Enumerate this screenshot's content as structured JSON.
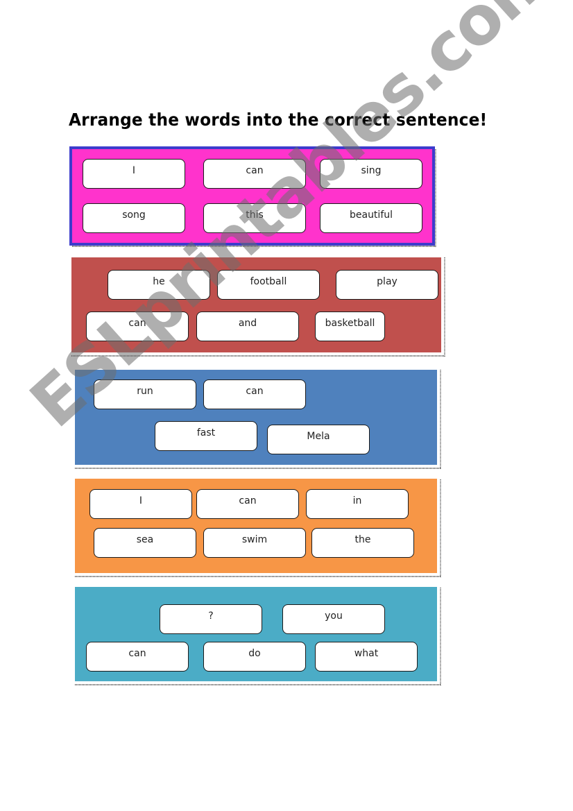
{
  "worksheet": {
    "title": "Arrange the words into the correct sentence!",
    "watermark": "ESLprintables.com",
    "panel_colors": {
      "pink": "#ff33cc",
      "pink_border": "#3c3ccc",
      "red": "#c0504d",
      "blue": "#4f81bd",
      "orange": "#f79646",
      "teal": "#4bacc6"
    },
    "panels": [
      {
        "color": "pink",
        "words": [
          "I",
          "can",
          "sing",
          "song",
          "this",
          "beautiful"
        ]
      },
      {
        "color": "red",
        "words": [
          "he",
          "football",
          "play",
          "can",
          "and",
          "basketball"
        ]
      },
      {
        "color": "blue",
        "words": [
          "run",
          "can",
          "fast",
          "Mela"
        ]
      },
      {
        "color": "orange",
        "words": [
          "I",
          "can",
          "in",
          "sea",
          "swim",
          "the"
        ]
      },
      {
        "color": "teal",
        "words": [
          "?",
          "you",
          "can",
          "do",
          "what"
        ]
      }
    ]
  }
}
